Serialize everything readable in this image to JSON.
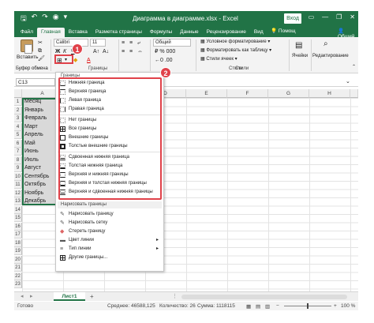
{
  "titlebar": {
    "autosave_icon": "save-icon",
    "title": "Диаграмма в диаграмме.xlsx - Excel",
    "signin": "Вход",
    "controls": [
      "—",
      "❐",
      "✕"
    ]
  },
  "tabs": [
    "Файл",
    "Главная",
    "Вставка",
    "Разметка страницы",
    "Формулы",
    "Данные",
    "Рецензирование",
    "Вид"
  ],
  "help": "Помощ",
  "share": "Общий",
  "ribbon": {
    "paste_label": "Вставить",
    "clipboard_label": "Буфер обмена",
    "font_name": "Calibri",
    "font_size": "11",
    "bold": "Ж",
    "italic": "К",
    "underline": "Ч",
    "borders_group_label": "Границы",
    "number_format": "Общий",
    "cond_format": "Условное форматирование",
    "format_table": "Форматировать как таблицу",
    "cell_styles": "Стили ячеек",
    "styles_label": "Стили",
    "cells_label": "Ячейки",
    "editing_label": "Редактирование"
  },
  "badges": {
    "one": "1",
    "two": "2"
  },
  "namebox": "C13",
  "columns": [
    "A",
    "B",
    "C",
    "D",
    "E",
    "F",
    "G",
    "H",
    "I"
  ],
  "rows": [
    "1",
    "2",
    "3",
    "4",
    "5",
    "6",
    "7",
    "8",
    "9",
    "10",
    "11",
    "12",
    "13",
    "14",
    "15",
    "16",
    "17",
    "18",
    "19",
    "20",
    "21",
    "22",
    "23"
  ],
  "months": [
    "Месяц",
    "Январь",
    "Февраль",
    "Март",
    "Апрель",
    "Май",
    "Июнь",
    "Июль",
    "Август",
    "Сентябрь",
    "Октябрь",
    "Ноябрь",
    "Декабрь"
  ],
  "menu": {
    "header": "Границы",
    "items": [
      {
        "label": "Нижняя граница",
        "icon": "border-bottom-icon"
      },
      {
        "label": "Верхняя граница",
        "icon": "border-top-icon"
      },
      {
        "label": "Левая граница",
        "icon": "border-left-icon"
      },
      {
        "label": "Правая граница",
        "icon": "border-right-icon"
      },
      {
        "label": "Нет границы",
        "icon": "border-none-icon"
      },
      {
        "label": "Все границы",
        "icon": "border-all-icon"
      },
      {
        "label": "Внешние границы",
        "icon": "border-outer-icon"
      },
      {
        "label": "Толстые внешние границы",
        "icon": "border-thick-outer-icon"
      },
      {
        "label": "Сдвоенная нижняя граница",
        "icon": "border-double-bottom-icon"
      },
      {
        "label": "Толстая нижняя граница",
        "icon": "border-thick-bottom-icon"
      },
      {
        "label": "Верхняя и нижняя границы",
        "icon": "border-top-bottom-icon"
      },
      {
        "label": "Верхняя и толстая нижняя границы",
        "icon": "border-top-thick-bottom-icon"
      },
      {
        "label": "Верхняя и сдвоенная нижняя границы",
        "icon": "border-top-double-bottom-icon"
      }
    ],
    "draw_section": "Нарисовать границы",
    "draw_items": [
      {
        "label": "Нарисовать границу",
        "icon": "pencil-icon"
      },
      {
        "label": "Нарисовать сетку",
        "icon": "pencil-grid-icon"
      },
      {
        "label": "Стереть границу",
        "icon": "eraser-icon"
      },
      {
        "label": "Цвет линии",
        "icon": "line-color-icon",
        "submenu": true
      },
      {
        "label": "Тип линии",
        "icon": "line-style-icon",
        "submenu": true
      },
      {
        "label": "Другие границы...",
        "icon": "more-borders-icon"
      }
    ]
  },
  "sheet": {
    "tab": "Лист1",
    "add": "+"
  },
  "status": {
    "ready": "Готово",
    "average": "Среднее: 46588,125",
    "count": "Количество: 26",
    "sum": "Сумма: 1118115",
    "zoom": "100 %"
  },
  "colors": {
    "excel_green": "#217346",
    "annotation_red": "#e0424a"
  }
}
